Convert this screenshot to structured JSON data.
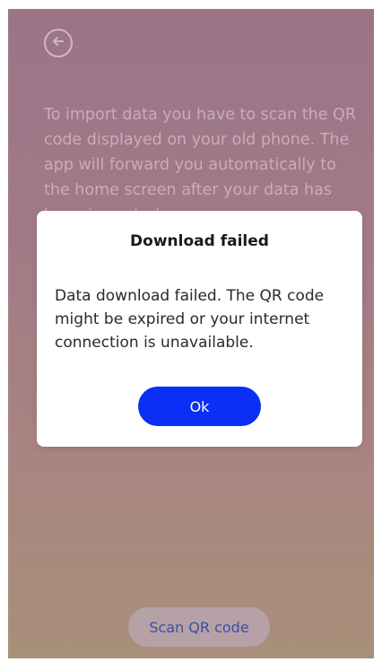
{
  "screen": {
    "instructions": "To import data you have to scan the QR code displayed on your old phone. The app will forward you automatically to the home screen after your data has been imported.",
    "scan_button_label": "Scan QR code",
    "back_icon": "arrow-left-circle-icon"
  },
  "dialog": {
    "title": "Download failed",
    "message": "Data download failed. The QR code might be expired or your internet connection is unavailable.",
    "ok_label": "Ok"
  },
  "colors": {
    "primary": "#0a2ff5",
    "dialog_bg": "#ffffff"
  }
}
